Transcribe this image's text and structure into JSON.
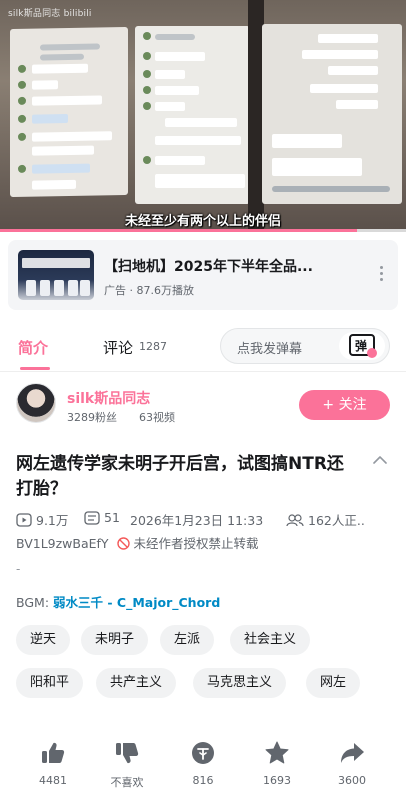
{
  "video": {
    "channel_watermark": "silk斯品同志 bilibili",
    "subtitle": "未经至少有两个以上的伴侣",
    "progress_fraction": 0.88
  },
  "ad": {
    "title": "【扫地机】2025年下半年全品...",
    "meta": "广告 · 87.6万播放"
  },
  "tabs": {
    "intro_label": "简介",
    "comment_label": "评论",
    "comment_count": "1287",
    "danmaku_placeholder": "点我发弹幕",
    "danmaku_icon_text": "弹"
  },
  "uploader": {
    "name": "silk斯品同志",
    "fans": "3289粉丝",
    "videos": "63视频",
    "follow_label": "+ 关注"
  },
  "video_info": {
    "title": "网左遗传学家未明子开后宫，试图搞NTR还打胎？",
    "views": "9.1万",
    "danmaku_count": "51",
    "publish_time": "2026年1月23日 11:33",
    "watching": "162人正..",
    "bvid": "BV1L9zwBaEfY",
    "copyright_notice": "未经作者授权禁止转载",
    "description": "-",
    "bgm_label": "BGM:",
    "bgm_song": "弱水三千 - C_Major_Chord"
  },
  "tags": [
    "逆天",
    "未明子",
    "左派",
    "社会主义",
    "阳和平",
    "共产主义",
    "马克思主义",
    "网左"
  ],
  "actions": {
    "like": "4481",
    "dislike": "不喜欢",
    "coin": "816",
    "favorite": "1693",
    "share": "3600"
  },
  "colors": {
    "brand_pink": "#fb7299",
    "link_blue": "#008ac5",
    "text_primary": "#18191c",
    "text_secondary": "#61666d"
  }
}
